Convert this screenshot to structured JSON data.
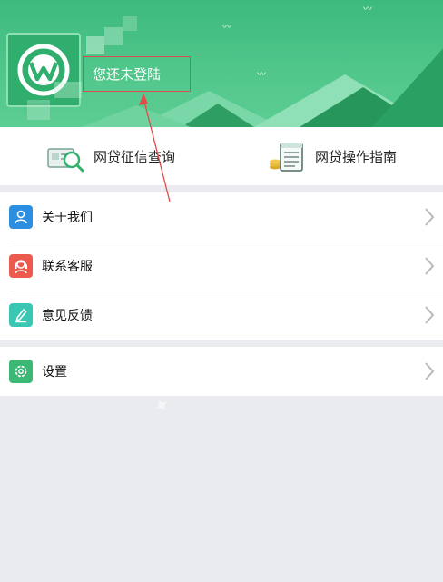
{
  "profile": {
    "login_status": "您还未登陆"
  },
  "quick_actions": [
    {
      "label": "网贷征信查询",
      "icon": "credit-search-icon"
    },
    {
      "label": "网贷操作指南",
      "icon": "guide-document-icon"
    }
  ],
  "menu_group_1": [
    {
      "label": "关于我们",
      "icon": "user-profile-icon",
      "color": "#2b8ee0"
    },
    {
      "label": "联系客服",
      "icon": "customer-service-icon",
      "color": "#ec5a4d"
    },
    {
      "label": "意见反馈",
      "icon": "feedback-pen-icon",
      "color": "#39c7b4"
    }
  ],
  "menu_group_2": [
    {
      "label": "设置",
      "icon": "gear-icon",
      "color": "#3cb874"
    }
  ],
  "colors": {
    "header_green": "#3dba7e",
    "annotation_red": "#e24b4b"
  }
}
